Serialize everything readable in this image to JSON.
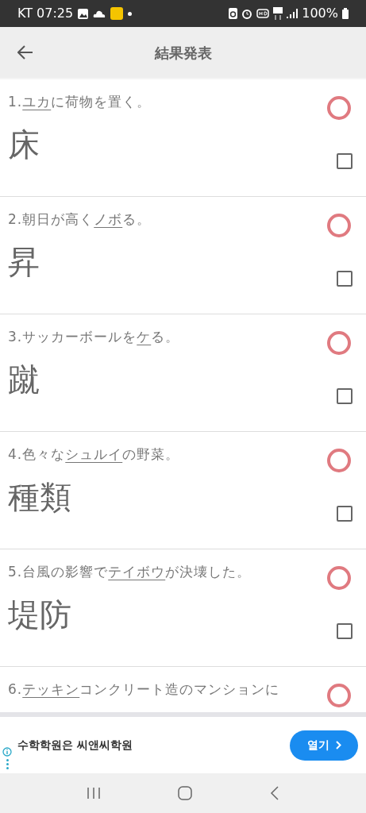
{
  "status_bar": {
    "carrier_time": "KT 07:25",
    "battery": "100%"
  },
  "header": {
    "title": "結果発表"
  },
  "questions": [
    {
      "number": "1.",
      "underlined": "ユカ",
      "rest": "に荷物を置く。",
      "answer": "床",
      "correct": true,
      "checked": false
    },
    {
      "number": "2.",
      "before": "朝日が高く",
      "underlined": "ノボ",
      "rest": "る。",
      "answer": "昇",
      "correct": true,
      "checked": false
    },
    {
      "number": "3.",
      "before": "サッカーボールを",
      "underlined": "ケ",
      "rest": "る。",
      "answer": "蹴",
      "correct": true,
      "checked": false
    },
    {
      "number": "4.",
      "before": "色々な",
      "underlined": "シュルイ",
      "rest": "の野菜。",
      "answer": "種類",
      "correct": true,
      "checked": false
    },
    {
      "number": "5.",
      "before": "台風の影響で",
      "underlined": "テイボウ",
      "rest": "が決壊した。",
      "answer": "堤防",
      "correct": true,
      "checked": false
    },
    {
      "number": "6.",
      "underlined": "テッキン",
      "rest": "コンクリート造のマンションに",
      "correct": true
    }
  ],
  "ad": {
    "text": "수학학원은 씨앤씨학원",
    "button": "열기"
  }
}
